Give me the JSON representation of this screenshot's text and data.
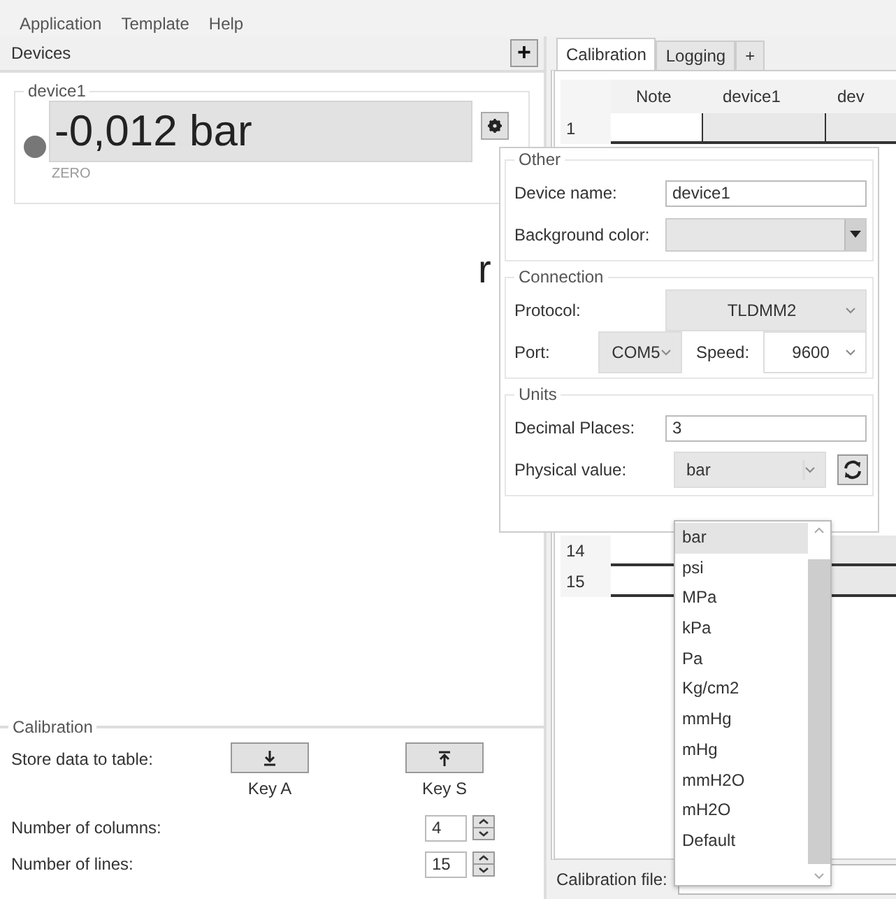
{
  "menu": [
    {
      "label": "Application"
    },
    {
      "label": "Template"
    },
    {
      "label": "Help"
    }
  ],
  "devices_panel": {
    "title": "Devices",
    "add_button": "+",
    "device": {
      "name": "device1",
      "reading": "-0,012 bar",
      "status": "ZERO"
    },
    "stray_text": "r"
  },
  "calibration": {
    "title": "Calibration",
    "store_label": "Store data to table:",
    "keys": [
      {
        "label": "Key A",
        "kind": "down"
      },
      {
        "label": "Key S",
        "kind": "up"
      }
    ],
    "spinners": [
      {
        "label": "Number of columns:",
        "value": "4"
      },
      {
        "label": "Number of lines:",
        "value": "15"
      }
    ]
  },
  "tabs": [
    {
      "label": "Calibration",
      "selected": true
    },
    {
      "label": "Logging",
      "selected": false
    },
    {
      "label": "+",
      "selected": false
    }
  ],
  "table": {
    "columns": [
      "Note",
      "device1",
      "dev"
    ],
    "rows": [
      {
        "header": "1"
      },
      {
        "header": "14"
      },
      {
        "header": "15"
      }
    ]
  },
  "calibration_file": {
    "label": "Calibration file:"
  },
  "settings_popup": {
    "other": {
      "title": "Other",
      "device_name_label": "Device name:",
      "device_name": "device1",
      "bg_label": "Background color:"
    },
    "connection": {
      "title": "Connection",
      "protocol_label": "Protocol:",
      "protocol": "TLDMM2",
      "port_label": "Port:",
      "port": "COM5",
      "speed_label": "Speed:",
      "speed": "9600"
    },
    "units": {
      "title": "Units",
      "decimals_label": "Decimal Places:",
      "decimals": "3",
      "physical_label": "Physical value:",
      "physical": "bar"
    }
  },
  "unit_options": [
    {
      "label": "bar",
      "selected": true
    },
    {
      "label": "psi",
      "selected": false
    },
    {
      "label": "MPa",
      "selected": false
    },
    {
      "label": "kPa",
      "selected": false
    },
    {
      "label": "Pa",
      "selected": false
    },
    {
      "label": "Kg/cm2",
      "selected": false
    },
    {
      "label": "mmHg",
      "selected": false
    },
    {
      "label": "mHg",
      "selected": false
    },
    {
      "label": "mmH2O",
      "selected": false
    },
    {
      "label": "mH2O",
      "selected": false
    },
    {
      "label": "Default",
      "selected": false
    }
  ]
}
